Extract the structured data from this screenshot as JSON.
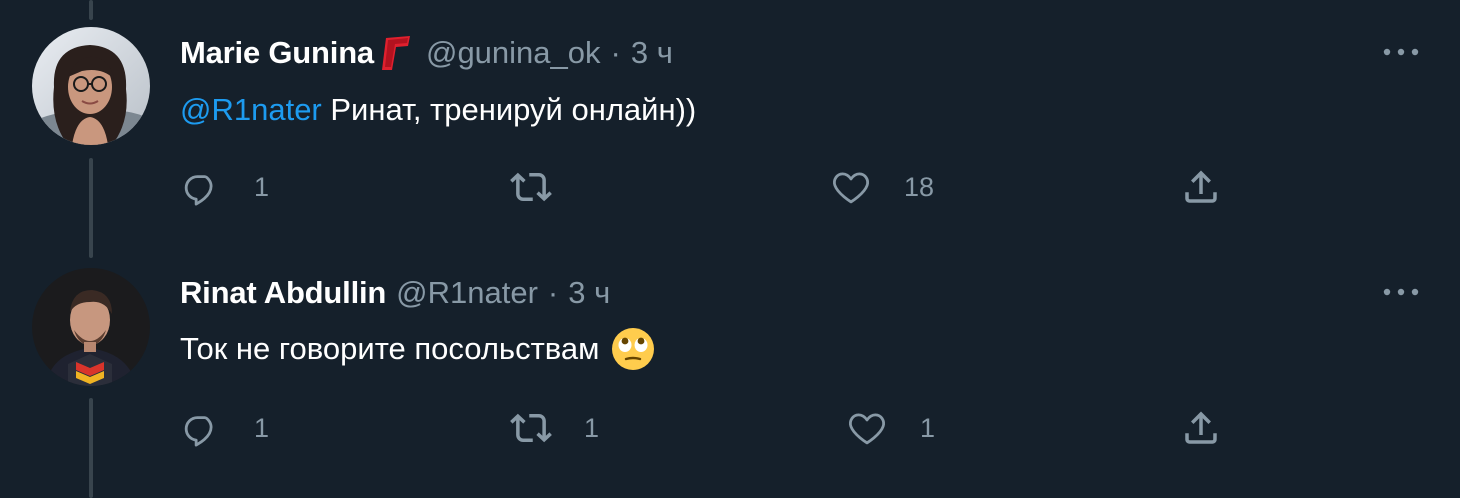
{
  "tweets": [
    {
      "display_name": "Marie Gunina",
      "handle": "@gunina_ok",
      "separator": "·",
      "time": "3 ч",
      "mention": "@R1nater",
      "text": " Ринат, тренируй онлайн))",
      "badge_icon": "brand-flag-icon",
      "counts": {
        "reply": "1",
        "retweet": "",
        "like": "18"
      }
    },
    {
      "display_name": "Rinat Abdullin",
      "handle": "@R1nater",
      "separator": "·",
      "time": "3 ч",
      "text": "Ток не говорите посольствам",
      "emoji_icon": "face-with-rolling-eyes-emoji",
      "counts": {
        "reply": "1",
        "retweet": "1",
        "like": "1"
      }
    }
  ],
  "colors": {
    "background": "#15202b",
    "thread_line": "#38444d",
    "secondary_text": "#8899a6",
    "mention": "#1d9bf0",
    "badge": "#e0202e"
  }
}
